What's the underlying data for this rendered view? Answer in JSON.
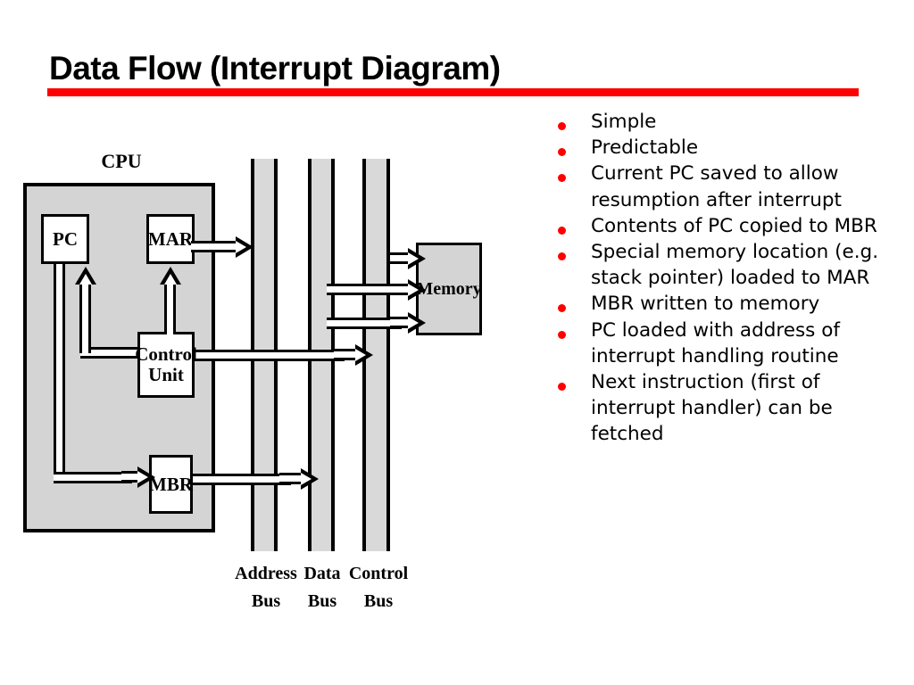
{
  "slide": {
    "title": "Data Flow (Interrupt Diagram)",
    "rule_color": "#FF0000"
  },
  "bullets": {
    "marker_color": "#FF0000",
    "items": [
      "Simple",
      "Predictable",
      "Current PC saved to allow resumption after interrupt",
      "Contents of PC copied to MBR",
      "Special memory location (e.g. stack pointer) loaded to MAR",
      "MBR written to memory",
      "PC loaded with address of interrupt handling routine",
      "Next instruction (first of interrupt handler) can be fetched"
    ]
  },
  "diagram": {
    "cpu_label": "CPU",
    "registers": {
      "pc": "PC",
      "mar": "MAR",
      "control_unit_line1": "Control",
      "control_unit_line2": "Unit",
      "mbr": "MBR"
    },
    "memory_label": "Memory",
    "buses": [
      {
        "name": "address",
        "line1": "Address",
        "line2": "Bus"
      },
      {
        "name": "data",
        "line1": "Data",
        "line2": "Bus"
      },
      {
        "name": "control",
        "line1": "Control",
        "line2": "Bus"
      }
    ],
    "colors": {
      "cpu_fill": "#d4d4d4",
      "bus_fill": "#d9d9d9",
      "memory_fill": "#d4d4d4",
      "register_fill": "#ffffff",
      "line": "#000000"
    }
  }
}
